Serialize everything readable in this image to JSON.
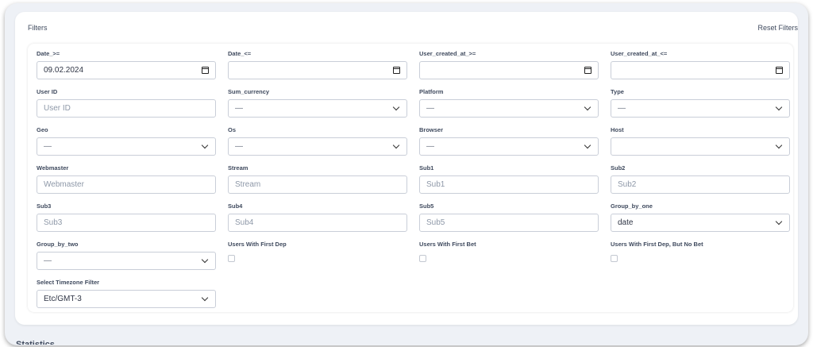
{
  "filters": {
    "title": "Filters",
    "reset_label": "Reset Filters",
    "date_from": {
      "label": "Date_>=",
      "value": "09.02.2024"
    },
    "date_to": {
      "label": "Date_<=",
      "value": ""
    },
    "user_created_from": {
      "label": "User_created_at_>=",
      "value": ""
    },
    "user_created_to": {
      "label": "User_created_at_<=",
      "value": ""
    },
    "user_id": {
      "label": "User ID",
      "placeholder": "User ID"
    },
    "sum_currency": {
      "label": "Sum_currency",
      "value": "—"
    },
    "platform": {
      "label": "Platform",
      "value": "—"
    },
    "type": {
      "label": "Type",
      "value": "—"
    },
    "geo": {
      "label": "Geo",
      "value": "—"
    },
    "os": {
      "label": "Os",
      "value": "—"
    },
    "browser": {
      "label": "Browser",
      "value": "—"
    },
    "host": {
      "label": "Host",
      "value": ""
    },
    "webmaster": {
      "label": "Webmaster",
      "placeholder": "Webmaster"
    },
    "stream": {
      "label": "Stream",
      "placeholder": "Stream"
    },
    "sub1": {
      "label": "Sub1",
      "placeholder": "Sub1"
    },
    "sub2": {
      "label": "Sub2",
      "placeholder": "Sub2"
    },
    "sub3": {
      "label": "Sub3",
      "placeholder": "Sub3"
    },
    "sub4": {
      "label": "Sub4",
      "placeholder": "Sub4"
    },
    "sub5": {
      "label": "Sub5",
      "placeholder": "Sub5"
    },
    "group_by_one": {
      "label": "Group_by_one",
      "value": "date"
    },
    "group_by_two": {
      "label": "Group_by_two",
      "value": "—"
    },
    "first_dep": {
      "label": "Users With First Dep",
      "checked": false
    },
    "first_bet": {
      "label": "Users With First Bet",
      "checked": false
    },
    "first_dep_no_bet": {
      "label": "Users With First Dep, But No Bet",
      "checked": false
    },
    "timezone": {
      "label": "Select Timezone Filter",
      "value": "Etc/GMT-3"
    }
  },
  "statistics": {
    "title": "Statistics"
  }
}
